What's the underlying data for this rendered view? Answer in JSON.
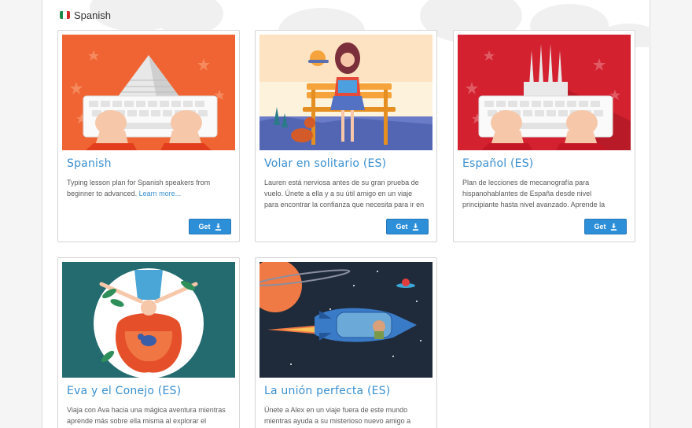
{
  "section": {
    "title": "Spanish",
    "flag_colors": [
      "#1f8a4c",
      "#ffffff",
      "#d42a2a"
    ]
  },
  "cards": [
    {
      "title": "Spanish",
      "description": "Typing lesson plan for Spanish speakers from beginner to advanced.",
      "link": "Learn more...",
      "button": "Get",
      "icon": "download-icon"
    },
    {
      "title": "Volar en solitario (ES)",
      "description": "Lauren está nerviosa antes de su gran prueba de vuelo. Únete a ella y a su útil amigo en un viaje para encontrar la confianza que necesita para ir en",
      "button": "Get",
      "icon": "download-icon"
    },
    {
      "title": "Español (ES)",
      "description": "Plan de lecciones de mecanografía para hispanohablantes de España desde nivel principiante hasta nivel avanzado. Aprende la",
      "button": "Get",
      "icon": "download-icon"
    },
    {
      "title": "Eva y el Conejo (ES)",
      "description": "Viaja con Ava hacia una mágica aventura mientras aprende más sobre ella misma al explorar el"
    },
    {
      "title": "La unión perfecta (ES)",
      "description": "Únete a Alex en un viaje fuera de este mundo mientras ayuda a su misterioso nuevo amigo a"
    }
  ],
  "colors": {
    "accent": "#3a8fd0",
    "button": "#2d8fd8",
    "orange": "#f06433",
    "red": "#d3212f",
    "teal": "#246b70",
    "space": "#1f2b3a"
  }
}
